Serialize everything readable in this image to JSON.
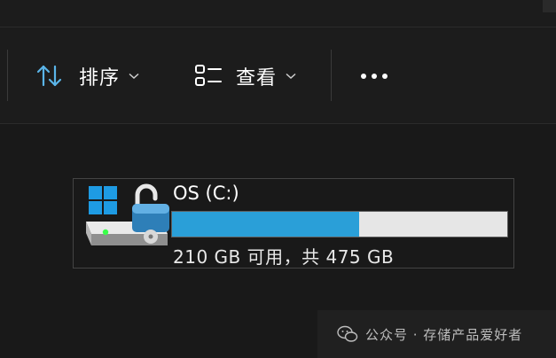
{
  "toolbar": {
    "sort_label": "排序",
    "view_label": "查看",
    "sort_icon": "sort-arrows-icon",
    "view_icon": "view-layout-icon",
    "more_icon": "more-dots-icon",
    "dropdown_icon": "chevron-down-icon"
  },
  "drive": {
    "name": "OS (C:)",
    "free_text": "210 GB 可用，共 475 GB",
    "used_fraction": 0.558,
    "icons": [
      "windows-logo-icon",
      "hard-drive-icon",
      "unlocked-padlock-icon"
    ]
  },
  "watermark": {
    "text": "公众号 · 存储产品爱好者",
    "icon": "wechat-icon"
  },
  "colors": {
    "background": "#191919",
    "usage_fill": "#2a9fd8",
    "usage_track": "#e6e6e6",
    "accent_icon": "#4fc3f7"
  }
}
